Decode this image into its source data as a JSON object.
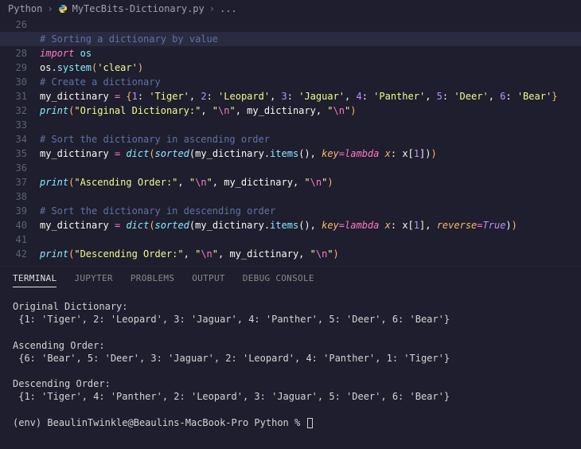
{
  "breadcrumb": {
    "root": "Python",
    "file": "MyTecBits-Dictionary.py",
    "more": "..."
  },
  "lines": {
    "start": 26,
    "end": 42
  },
  "code": {
    "l27_comment": "# Sorting a dictionary by value",
    "l28_import": "import",
    "l28_os": "os",
    "l29_os": "os",
    "l29_system": "system",
    "l29_clear": "'clear'",
    "l30_comment": "# Create a dictionary",
    "l31_var": "my_dictinary",
    "l31_k1": "1",
    "l31_v1": "'Tiger'",
    "l31_k2": "2",
    "l31_v2": "'Leopard'",
    "l31_k3": "3",
    "l31_v3": "'Jaguar'",
    "l31_k4": "4",
    "l31_v4": "'Panther'",
    "l31_k5": "5",
    "l31_v5": "'Deer'",
    "l31_k6": "6",
    "l31_v6": "'Bear'",
    "l32_print": "print",
    "l32_s1": "\"Original Dictionary:\"",
    "l32_nl": "\"\\n\"",
    "l32_var": "my_dictinary",
    "l34_comment": "# Sort the dictionary in ascending order",
    "l35_var": "my_dictinary",
    "l35_dict": "dict",
    "l35_sorted": "sorted",
    "l35_items": "items",
    "l35_key": "key",
    "l35_lambda": "lambda",
    "l35_x": "x",
    "l35_idx": "1",
    "l37_print": "print",
    "l37_s1": "\"Ascending Order:\"",
    "l39_comment": "# Sort the dictionary in descending order",
    "l40_reverse": "reverse",
    "l40_true": "True",
    "l42_s1": "\"Descending Order:\""
  },
  "tabs": {
    "terminal": "TERMINAL",
    "jupyter": "JUPYTER",
    "problems": "PROBLEMS",
    "output": "OUTPUT",
    "debug": "DEBUG CONSOLE"
  },
  "terminal": {
    "l1": "Original Dictionary:",
    "l2": " {1: 'Tiger', 2: 'Leopard', 3: 'Jaguar', 4: 'Panther', 5: 'Deer', 6: 'Bear'} ",
    "l3": "",
    "l4": "Ascending Order:",
    "l5": " {6: 'Bear', 5: 'Deer', 3: 'Jaguar', 2: 'Leopard', 4: 'Panther', 1: 'Tiger'} ",
    "l6": "",
    "l7": "Descending Order:",
    "l8": " {1: 'Tiger', 4: 'Panther', 2: 'Leopard', 3: 'Jaguar', 5: 'Deer', 6: 'Bear'} ",
    "l9": "",
    "prompt": "(env) BeaulinTwinkle@Beaulins-MacBook-Pro Python % "
  }
}
